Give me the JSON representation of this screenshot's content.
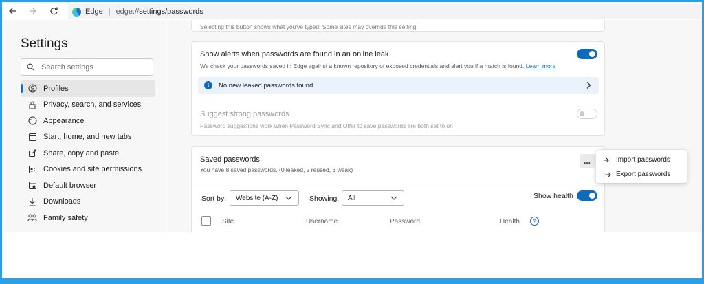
{
  "browser": {
    "site_label": "Edge",
    "url_host": "edge://",
    "url_path": "settings/passwords"
  },
  "sidebar": {
    "title": "Settings",
    "search_placeholder": "Search settings",
    "items": [
      {
        "label": "Profiles",
        "icon": "profile-icon",
        "active": true
      },
      {
        "label": "Privacy, search, and services",
        "icon": "lock-icon"
      },
      {
        "label": "Appearance",
        "icon": "appearance-icon"
      },
      {
        "label": "Start, home, and new tabs",
        "icon": "start-home-icon"
      },
      {
        "label": "Share, copy and paste",
        "icon": "share-icon"
      },
      {
        "label": "Cookies and site permissions",
        "icon": "cookies-icon"
      },
      {
        "label": "Default browser",
        "icon": "default-browser-icon"
      },
      {
        "label": "Downloads",
        "icon": "download-icon"
      },
      {
        "label": "Family safety",
        "icon": "family-icon"
      }
    ]
  },
  "main": {
    "top_card_text": "Selecting this button shows what you've typed. Some sites may override this setting",
    "leak_alert": {
      "title": "Show alerts when passwords are found in an online leak",
      "desc": "We check your passwords saved in Edge against a known repository of exposed credentials and alert you if a match is found.",
      "learn_more": "Learn more",
      "enabled": true,
      "status": "No new leaked passwords found"
    },
    "suggest": {
      "title": "Suggest strong passwords",
      "desc": "Password suggestions work when Password Sync and Offer to save passwords are both set to on",
      "enabled": false
    },
    "saved": {
      "title": "Saved passwords",
      "summary": "You have 8 saved passwords. (0 leaked, 2 reused, 3 weak)",
      "more_label": "...",
      "sort_label": "Sort by:",
      "sort_value": "Website (A-Z)",
      "showing_label": "Showing:",
      "showing_value": "All",
      "show_health_label": "Show health",
      "show_health_enabled": true,
      "columns": [
        "Site",
        "Username",
        "Password",
        "Health"
      ]
    }
  },
  "menu": {
    "items": [
      {
        "label": "Import passwords",
        "icon": "import-icon"
      },
      {
        "label": "Export passwords",
        "icon": "export-icon"
      }
    ]
  },
  "colors": {
    "accent": "#0f6cbd",
    "frame": "#2a9ee6"
  }
}
